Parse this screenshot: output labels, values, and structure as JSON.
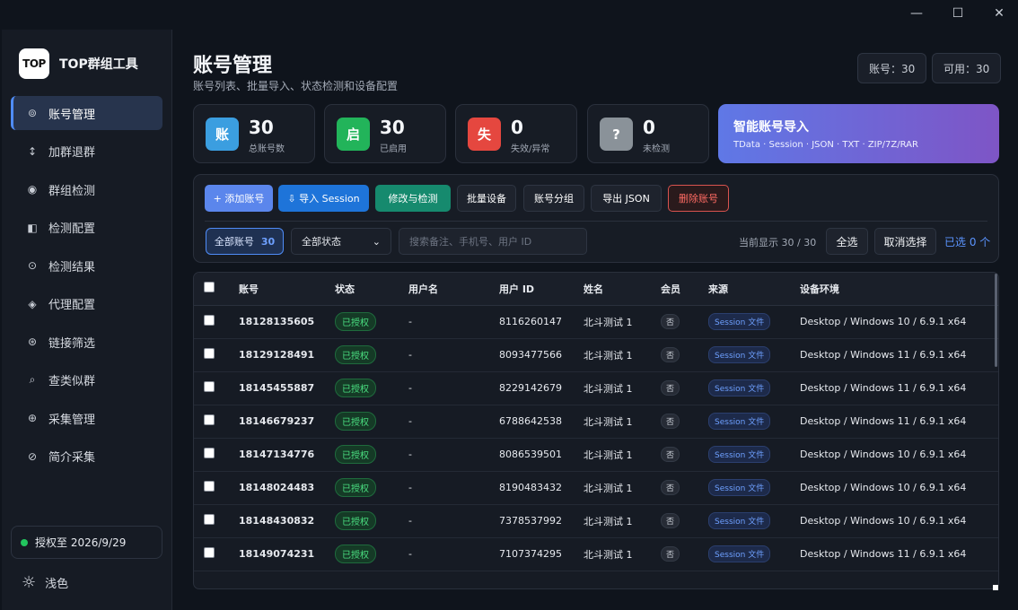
{
  "window": {
    "minimize": "—",
    "maximize": "☐",
    "close": "✕"
  },
  "sidebar": {
    "logo_mark": "TOP",
    "app_name": "TOP群组工具",
    "items": [
      {
        "label": "账号管理",
        "icon": "⊚",
        "active": true
      },
      {
        "label": "加群退群",
        "icon": "↕"
      },
      {
        "label": "群组检测",
        "icon": "◉"
      },
      {
        "label": "检测配置",
        "icon": "◧"
      },
      {
        "label": "检测结果",
        "icon": "⊙"
      },
      {
        "label": "代理配置",
        "icon": "◈"
      },
      {
        "label": "链接筛选",
        "icon": "⊛"
      },
      {
        "label": "查类似群",
        "icon": "⌕"
      },
      {
        "label": "采集管理",
        "icon": "⊕"
      },
      {
        "label": "简介采集",
        "icon": "⊘"
      }
    ],
    "license": "授权至 2026/9/29",
    "theme_label": "浅色"
  },
  "header": {
    "title": "账号管理",
    "subtitle": "账号列表、批量导入、状态检测和设备配置",
    "count_pill": "账号：30",
    "avail_pill": "可用：30"
  },
  "stats": [
    {
      "icon": "账",
      "value": "30",
      "label": "总账号数",
      "color": "#3b9ee0"
    },
    {
      "icon": "启",
      "value": "30",
      "label": "已启用",
      "color": "#22b45a"
    },
    {
      "icon": "失",
      "value": "0",
      "label": "失效/异常",
      "color": "#e5473f"
    },
    {
      "icon": "?",
      "value": "0",
      "label": "未检测",
      "color": "#8a9299"
    }
  ],
  "import_card": {
    "title": "智能账号导入",
    "subtitle": "TData · Session · JSON · TXT · ZIP/7Z/RAR"
  },
  "toolbar": {
    "add": "+ 添加账号",
    "import_session": "⇩ 导入 Session",
    "modify": "修改与检测",
    "batch_device": "批量设备",
    "group": "账号分组",
    "export": "导出 JSON",
    "delete": "删除账号"
  },
  "filters": {
    "all_label": "全部账号",
    "all_count": "30",
    "status_value": "全部状态",
    "search_placeholder": "搜索备注、手机号、用户 ID",
    "showing": "当前显示 30 / 30",
    "select_all": "全选",
    "deselect": "取消选择",
    "selected": "已选 0 个"
  },
  "table": {
    "headers": [
      "账号",
      "状态",
      "用户名",
      "用户 ID",
      "姓名",
      "会员",
      "来源",
      "设备环境"
    ],
    "rows": [
      {
        "account": "18128135605",
        "status": "已授权",
        "username": "-",
        "uid": "8116260147",
        "name": "北斗测试 1",
        "vip": "否",
        "source": "Session 文件",
        "device": "Desktop / Windows 10 / 6.9.1 x64"
      },
      {
        "account": "18129128491",
        "status": "已授权",
        "username": "-",
        "uid": "8093477566",
        "name": "北斗测试 1",
        "vip": "否",
        "source": "Session 文件",
        "device": "Desktop / Windows 11 / 6.9.1 x64"
      },
      {
        "account": "18145455887",
        "status": "已授权",
        "username": "-",
        "uid": "8229142679",
        "name": "北斗测试 1",
        "vip": "否",
        "source": "Session 文件",
        "device": "Desktop / Windows 11 / 6.9.1 x64"
      },
      {
        "account": "18146679237",
        "status": "已授权",
        "username": "-",
        "uid": "6788642538",
        "name": "北斗测试 1",
        "vip": "否",
        "source": "Session 文件",
        "device": "Desktop / Windows 11 / 6.9.1 x64"
      },
      {
        "account": "18147134776",
        "status": "已授权",
        "username": "-",
        "uid": "8086539501",
        "name": "北斗测试 1",
        "vip": "否",
        "source": "Session 文件",
        "device": "Desktop / Windows 10 / 6.9.1 x64"
      },
      {
        "account": "18148024483",
        "status": "已授权",
        "username": "-",
        "uid": "8190483432",
        "name": "北斗测试 1",
        "vip": "否",
        "source": "Session 文件",
        "device": "Desktop / Windows 10 / 6.9.1 x64"
      },
      {
        "account": "18148430832",
        "status": "已授权",
        "username": "-",
        "uid": "7378537992",
        "name": "北斗测试 1",
        "vip": "否",
        "source": "Session 文件",
        "device": "Desktop / Windows 10 / 6.9.1 x64"
      },
      {
        "account": "18149074231",
        "status": "已授权",
        "username": "-",
        "uid": "7107374295",
        "name": "北斗测试 1",
        "vip": "否",
        "source": "Session 文件",
        "device": "Desktop / Windows 11 / 6.9.1 x64"
      }
    ]
  }
}
